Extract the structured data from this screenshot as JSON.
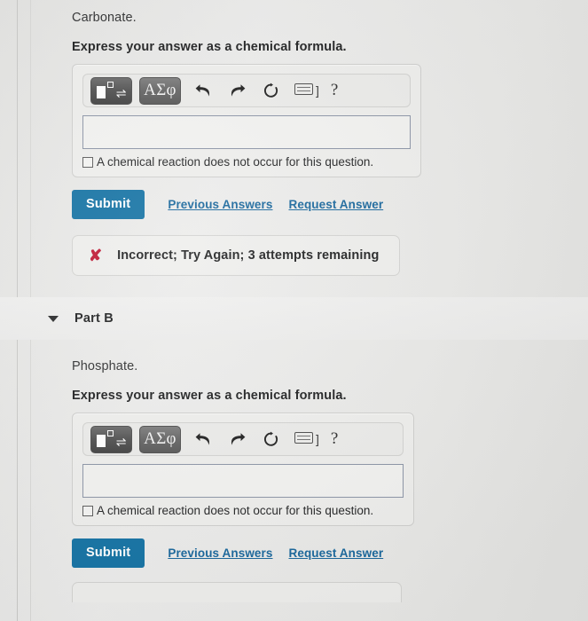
{
  "parts": [
    {
      "id": "part-a",
      "header": null,
      "prompt": "Carbonate.",
      "instruction": "Express your answer as a chemical formula.",
      "toolbar": {
        "template_button": "equation-template",
        "greek_button": "ΑΣφ",
        "undo": "undo-arrow",
        "redo": "redo-arrow",
        "reset": "reset-circle",
        "keyboard": "keyboard",
        "keyboard_bracket": "]",
        "help": "?"
      },
      "answer_value": "",
      "no_reaction_label": "A chemical reaction does not occur for this question.",
      "no_reaction_checked": false,
      "submit_label": "Submit",
      "previous_answers_label": "Previous Answers",
      "request_answer_label": "Request Answer",
      "feedback": {
        "icon": "incorrect-x",
        "text": "Incorrect; Try Again; 3 attempts remaining"
      }
    },
    {
      "id": "part-b",
      "header": "Part B",
      "prompt": "Phosphate.",
      "instruction": "Express your answer as a chemical formula.",
      "toolbar": {
        "template_button": "equation-template",
        "greek_button": "ΑΣφ",
        "undo": "undo-arrow",
        "redo": "redo-arrow",
        "reset": "reset-circle",
        "keyboard": "keyboard",
        "keyboard_bracket": "]",
        "help": "?"
      },
      "answer_value": "",
      "no_reaction_label": "A chemical reaction does not occur for this question.",
      "no_reaction_checked": false,
      "submit_label": "Submit",
      "previous_answers_label": "Previous Answers",
      "request_answer_label": "Request Answer",
      "feedback": null
    }
  ],
  "colors": {
    "submit_blue": "#1271a3",
    "link_blue": "#16659b",
    "incorrect_red": "#bf1430",
    "page_background": "#e9e9e7",
    "input_border": "#8b94a6"
  }
}
